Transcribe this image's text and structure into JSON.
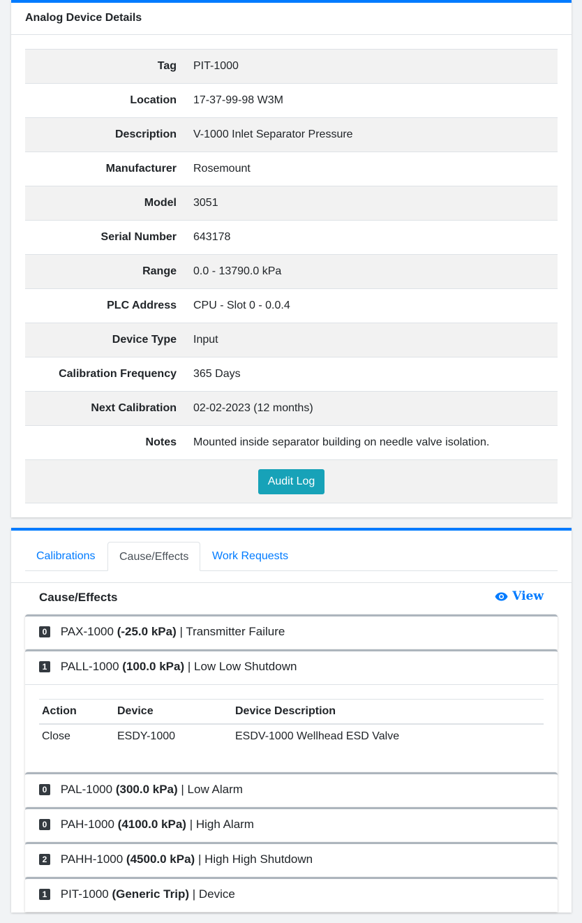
{
  "details_card": {
    "title": "Analog Device Details",
    "rows": [
      {
        "label": "Tag",
        "value": "PIT-1000"
      },
      {
        "label": "Location",
        "value": "17-37-99-98 W3M"
      },
      {
        "label": "Description",
        "value": "V-1000 Inlet Separator Pressure"
      },
      {
        "label": "Manufacturer",
        "value": "Rosemount"
      },
      {
        "label": "Model",
        "value": "3051"
      },
      {
        "label": "Serial Number",
        "value": "643178"
      },
      {
        "label": "Range",
        "value": "0.0 - 13790.0 kPa"
      },
      {
        "label": "PLC Address",
        "value": "CPU - Slot 0 - 0.0.4"
      },
      {
        "label": "Device Type",
        "value": "Input"
      },
      {
        "label": "Calibration Frequency",
        "value": "365 Days"
      },
      {
        "label": "Next Calibration",
        "value": "02-02-2023 (12 months)"
      },
      {
        "label": "Notes",
        "value": "Mounted inside separator building on needle valve isolation."
      }
    ],
    "audit_button": "Audit Log"
  },
  "tabs": [
    {
      "label": "Calibrations",
      "active": false
    },
    {
      "label": "Cause/Effects",
      "active": true
    },
    {
      "label": "Work Requests",
      "active": false
    }
  ],
  "cause_effects": {
    "title": "Cause/Effects",
    "view_label": "View",
    "items": [
      {
        "count": "0",
        "tag": "PAX-1000",
        "setpoint": "(-25.0 kPa)",
        "desc": "| Transmitter Failure"
      },
      {
        "count": "1",
        "tag": "PALL-1000",
        "setpoint": "(100.0 kPa)",
        "desc": "| Low Low Shutdown",
        "expanded": true,
        "table": {
          "headers": [
            "Action",
            "Device",
            "Device Description"
          ],
          "rows": [
            [
              "Close",
              "ESDY-1000",
              "ESDV-1000 Wellhead ESD Valve"
            ]
          ]
        }
      },
      {
        "count": "0",
        "tag": "PAL-1000",
        "setpoint": "(300.0 kPa)",
        "desc": "| Low Alarm"
      },
      {
        "count": "0",
        "tag": "PAH-1000",
        "setpoint": "(4100.0 kPa)",
        "desc": "| High Alarm"
      },
      {
        "count": "2",
        "tag": "PAHH-1000",
        "setpoint": "(4500.0 kPa)",
        "desc": "| High High Shutdown"
      },
      {
        "count": "1",
        "tag": "PIT-1000",
        "setpoint": "(Generic Trip)",
        "desc": "| Device"
      }
    ]
  }
}
